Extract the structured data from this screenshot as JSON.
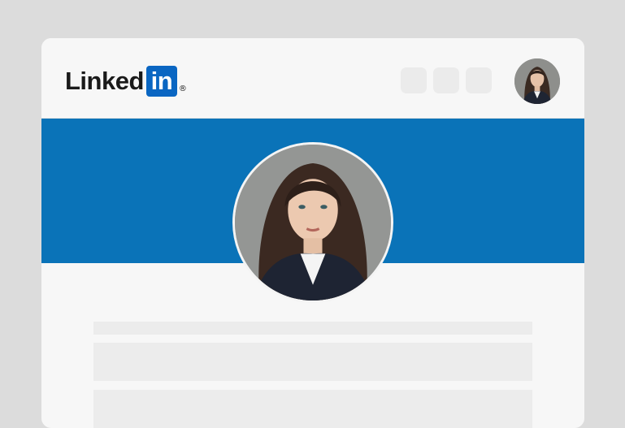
{
  "app": {
    "brand_word": "Linked",
    "brand_badge": "in",
    "brand_mark": "®",
    "brand_color": "#0a66c2"
  },
  "header": {
    "nav_placeholders": [
      "nav-placeholder",
      "nav-placeholder",
      "nav-placeholder"
    ],
    "avatar_icon": "user-avatar"
  },
  "banner": {
    "color": "#0a73b8"
  },
  "profile": {
    "avatar_icon": "profile-photo"
  },
  "content": {
    "skeleton_lines": 3
  }
}
